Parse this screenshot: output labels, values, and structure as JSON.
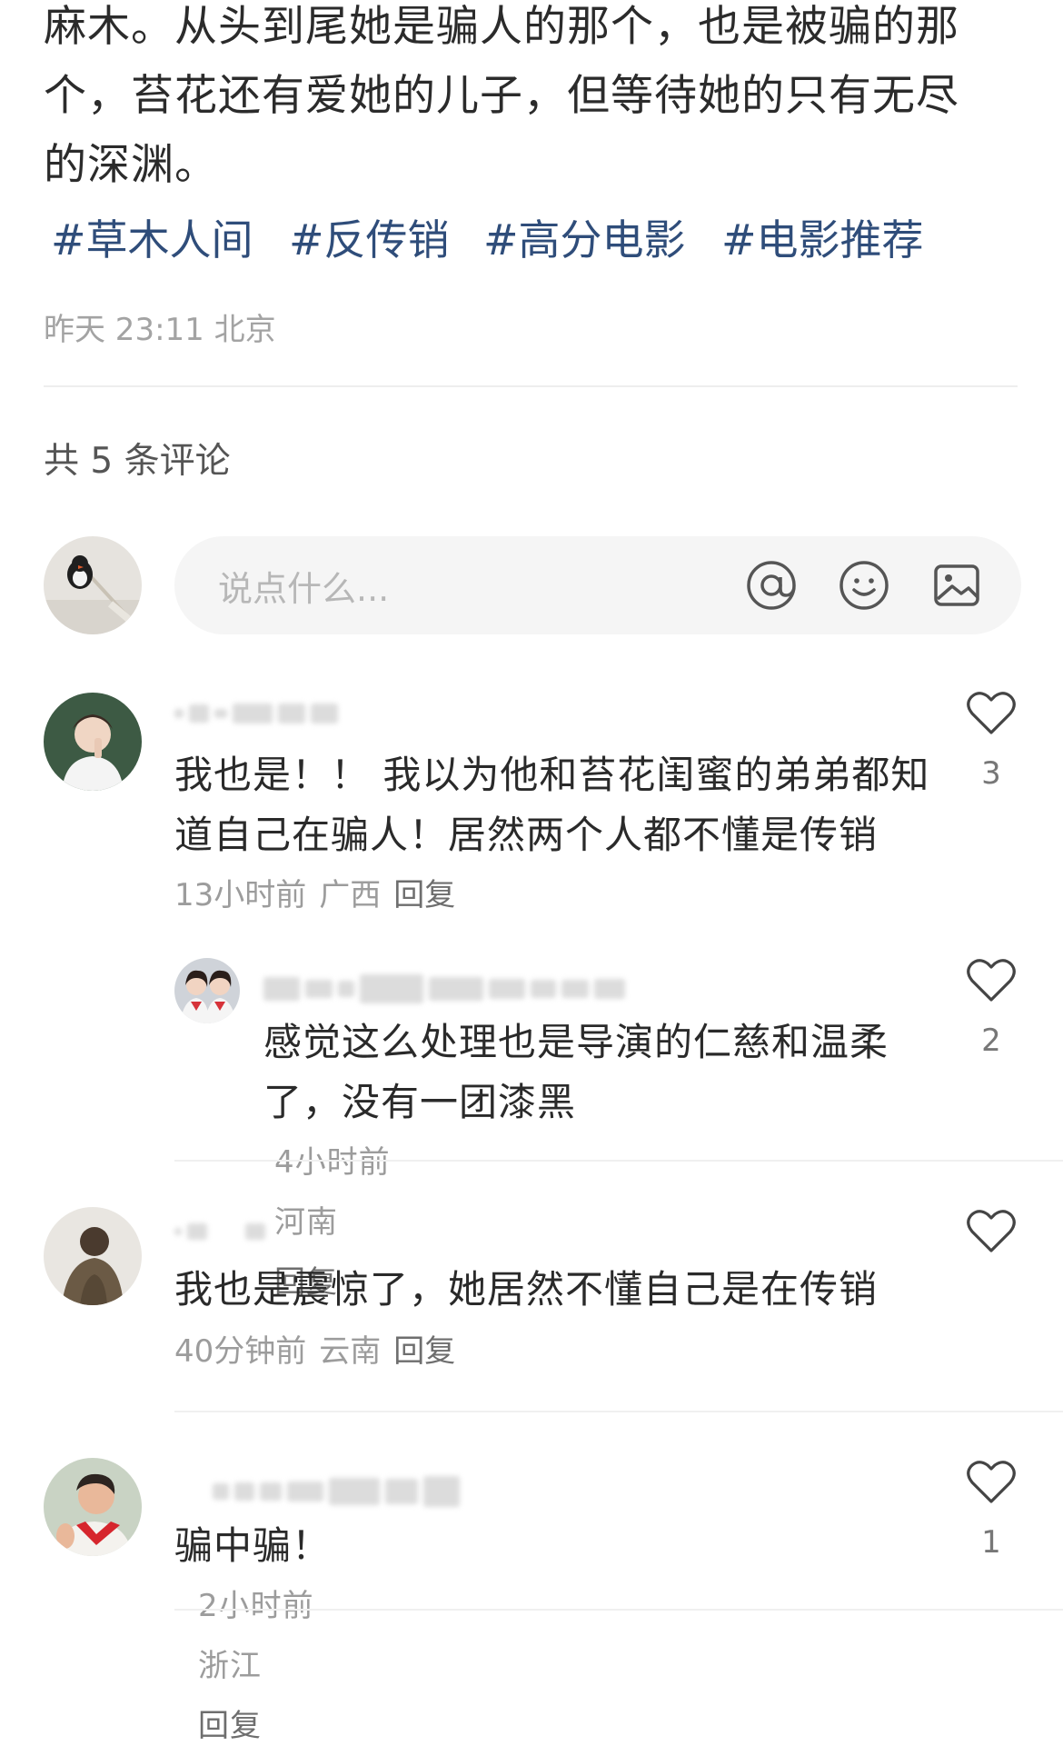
{
  "post": {
    "text_lines": [
      "麻木。从头到尾她是骗人的那个，也是被骗的那",
      "个，苔花还有爱她的儿子，但等待她的只有无尽",
      "的深渊。"
    ],
    "tags": [
      "#草木人间",
      "#反传销",
      "#高分电影",
      "#电影推荐"
    ],
    "meta": "昨天 23:11 北京"
  },
  "comments_header": "共 5 条评论",
  "input": {
    "placeholder": "说点什么...",
    "icons": [
      "at-icon",
      "emoji-icon",
      "image-icon"
    ]
  },
  "comments": [
    {
      "text_lines": [
        "我也是！！ 我以为他和苔花闺蜜的弟弟都知",
        "道自己在骗人！居然两个人都不懂是传销"
      ],
      "time": "13小时前",
      "location": "广西",
      "reply_label": "回复",
      "likes": "3",
      "reply": {
        "text_lines": [
          "感觉这么处理也是导演的仁慈和温柔",
          "了，没有一团漆黑"
        ],
        "time": "4小时前",
        "location": "河南",
        "reply_label": "回复",
        "likes": "2"
      }
    },
    {
      "text_lines": [
        "我也是震惊了，她居然不懂自己是在传销"
      ],
      "time": "40分钟前",
      "location": "云南",
      "reply_label": "回复",
      "likes": ""
    },
    {
      "text_lines": [
        "骗中骗！"
      ],
      "time": "2小时前",
      "location": "浙江",
      "reply_label": "回复",
      "likes": "1"
    }
  ],
  "colors": {
    "tag": "#2f4d7a",
    "meta": "#9c9c9c",
    "input_bg": "#f5f5f5",
    "divider": "#eeeeee"
  }
}
